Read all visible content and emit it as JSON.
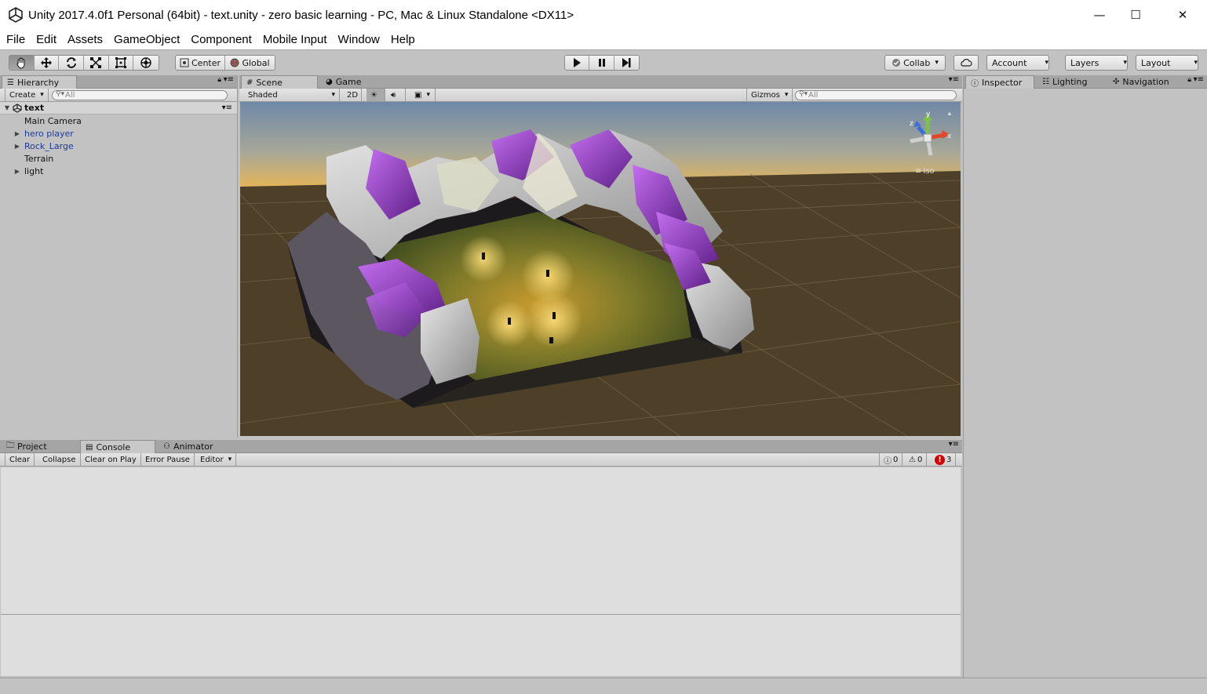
{
  "window": {
    "title": "Unity 2017.4.0f1 Personal (64bit) - text.unity - zero basic learning - PC, Mac & Linux Standalone <DX11>",
    "minimize_glyph": "—",
    "maximize_glyph": "☐",
    "close_glyph": "✕"
  },
  "menu": [
    "File",
    "Edit",
    "Assets",
    "GameObject",
    "Component",
    "Mobile Input",
    "Window",
    "Help"
  ],
  "toolbar": {
    "tools": [
      "hand-icon",
      "move-icon",
      "rotate-icon",
      "scale-icon",
      "rect-icon",
      "transform-icon"
    ],
    "pivot": "Center",
    "space": "Global",
    "collab": "Collab",
    "account": "Account",
    "layers": "Layers",
    "layout": "Layout"
  },
  "hierarchy": {
    "tab": "Hierarchy",
    "create": "Create",
    "search_placeholder": "All",
    "scene_name": "text",
    "items": [
      {
        "label": "Main Camera",
        "expandable": false,
        "prefab": false
      },
      {
        "label": "hero player",
        "expandable": true,
        "prefab": true
      },
      {
        "label": "Rock_Large",
        "expandable": true,
        "prefab": true
      },
      {
        "label": "Terrain",
        "expandable": false,
        "prefab": false
      },
      {
        "label": "light",
        "expandable": true,
        "prefab": false
      }
    ]
  },
  "scene": {
    "tabs": [
      "Scene",
      "Game"
    ],
    "shading": "Shaded",
    "mode_2d": "2D",
    "gizmos": "Gizmos",
    "search_placeholder": "All",
    "gizmo_axes": {
      "x": "x",
      "y": "y",
      "z": "z"
    },
    "projection": "Iso"
  },
  "inspector": {
    "tabs": [
      "Inspector",
      "Lighting",
      "Navigation"
    ]
  },
  "console": {
    "tabs": [
      "Project",
      "Console",
      "Animator"
    ],
    "buttons": [
      "Clear",
      "Collapse",
      "Clear on Play",
      "Error Pause",
      "Editor"
    ],
    "info_count": "0",
    "warning_count": "0",
    "error_count": "3"
  },
  "colors": {
    "accent": "#3c3c3c",
    "prefab_text": "#1c3b9b",
    "error": "#d40000",
    "ground": "#4d3f28",
    "crystal": "#9c3dd1"
  }
}
